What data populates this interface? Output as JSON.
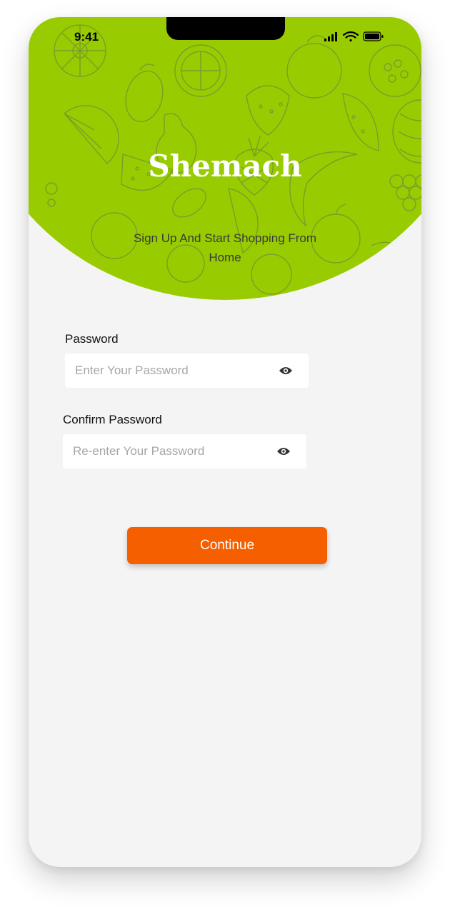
{
  "status_bar": {
    "time": "9:41",
    "icons": [
      "signal-icon",
      "wifi-icon",
      "battery-icon"
    ]
  },
  "header": {
    "title": "Shemach",
    "subtitle": "Sign Up And Start Shopping From Home",
    "pattern": "fruit-pattern"
  },
  "form": {
    "password": {
      "label": "Password",
      "placeholder": "Enter Your Password",
      "value": "",
      "toggle_icon": "eye-icon"
    },
    "confirm_password": {
      "label": "Confirm Password",
      "placeholder": "Re-enter Your Password",
      "value": "",
      "toggle_icon": "eye-icon"
    }
  },
  "continue_button": {
    "label": "Continue"
  },
  "colors": {
    "header_green": "#99cc00",
    "button_orange": "#f55f00",
    "background": "#f4f4f4"
  }
}
